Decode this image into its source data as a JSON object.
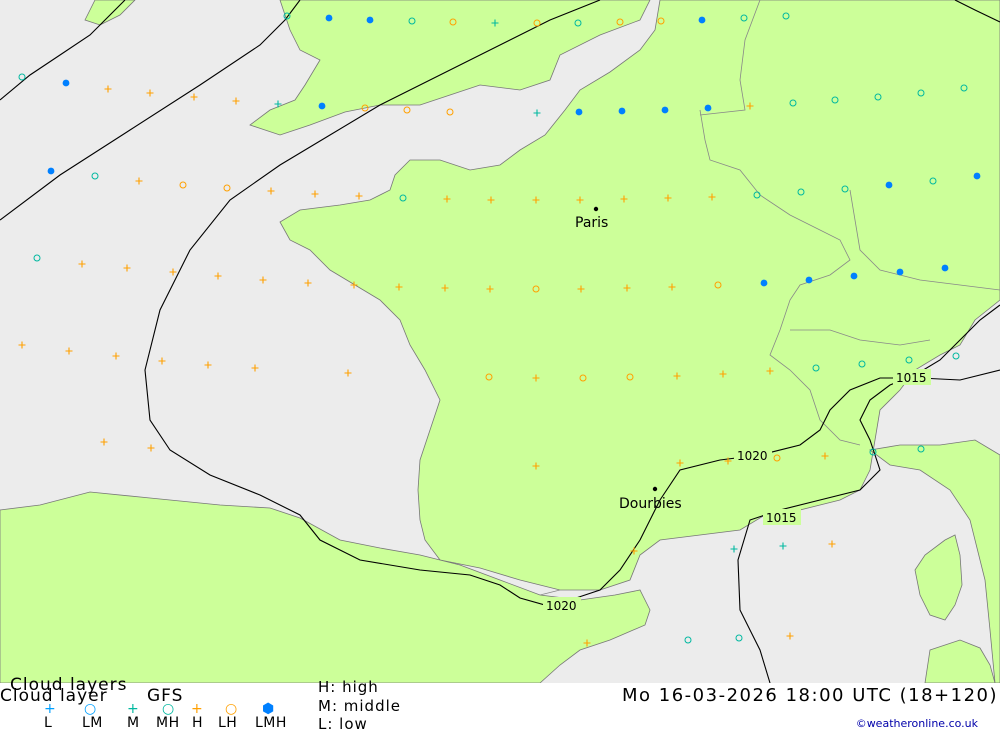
{
  "header": {
    "title_back": "Cloud layers",
    "title_front": "Cloud layer",
    "model": "GFS"
  },
  "legend": {
    "items": [
      {
        "label": "L",
        "glyph": "+",
        "color": "#00a0ff",
        "icon": "plus-icon"
      },
      {
        "label": "LM",
        "glyph": "○",
        "color": "#00a0ff",
        "icon": "ring-icon"
      },
      {
        "label": "M",
        "glyph": "+",
        "color": "#00b8a0",
        "icon": "plus-icon"
      },
      {
        "label": "MH",
        "glyph": "○",
        "color": "#00b8a0",
        "icon": "ring-icon"
      },
      {
        "label": "H",
        "glyph": "+",
        "color": "#ffa000",
        "icon": "plus-icon"
      },
      {
        "label": "LH",
        "glyph": "○",
        "color": "#ffa000",
        "icon": "ring-icon"
      },
      {
        "label": "LMH",
        "glyph": "⬢",
        "color": "#0080ff",
        "icon": "filled-dot-icon"
      }
    ],
    "key_high": "H:  high",
    "key_middle": "M:  middle",
    "key_low": "L:  low"
  },
  "datetime": "Mo 16-03-2026 18:00 UTC (18+120)",
  "credit": "©weatheronline.co.uk",
  "map": {
    "cities": [
      "Paris",
      "Dourbies"
    ],
    "isobars": [
      "1015",
      "1020",
      "1020",
      "1015"
    ],
    "colors": {
      "sea": "#ececec",
      "land": "#ccff99",
      "border": "#888888",
      "isobar": "#000000"
    }
  }
}
